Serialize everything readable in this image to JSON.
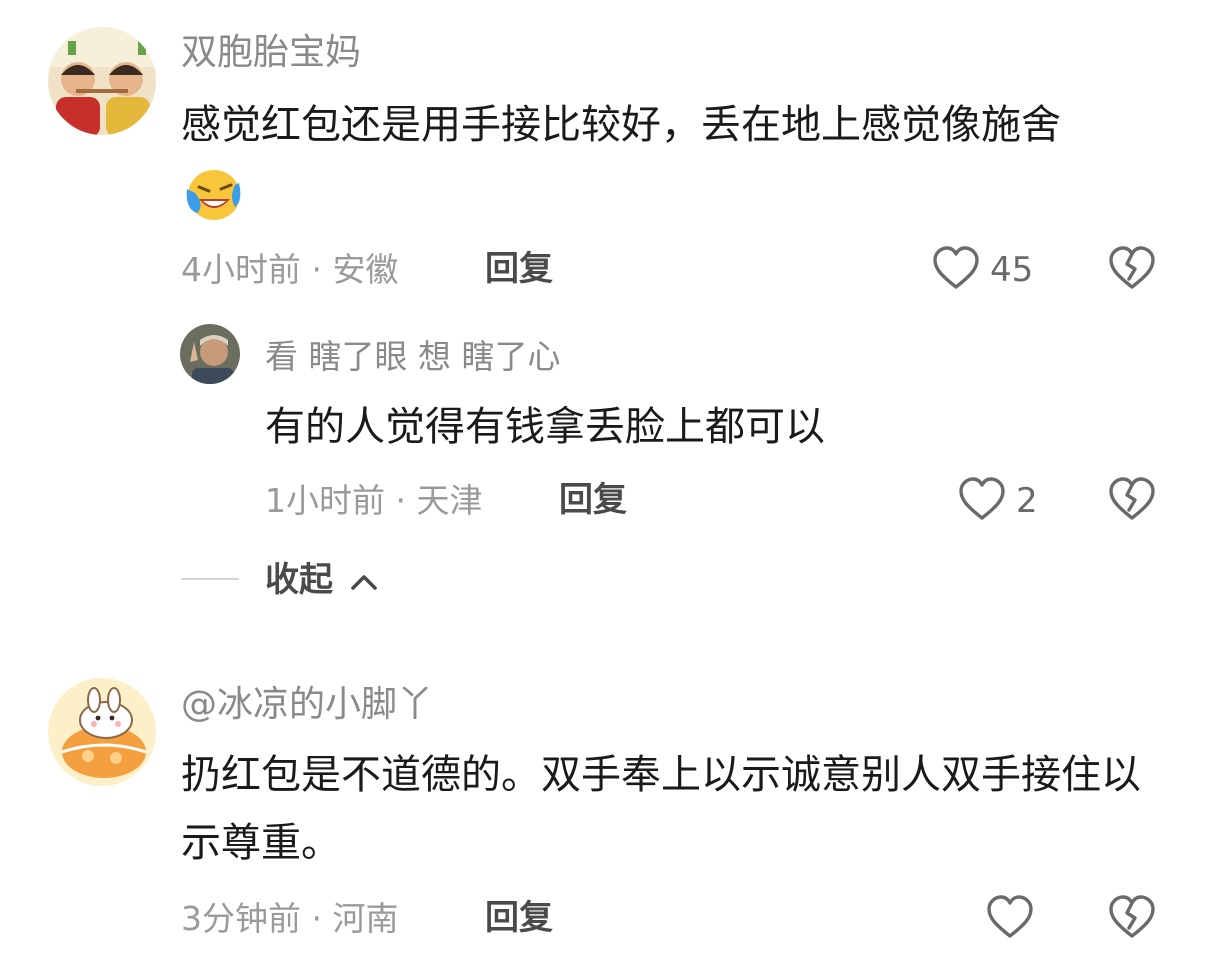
{
  "comments": [
    {
      "username": "双胞胎宝妈",
      "text": "感觉红包还是用手接比较好，丢在地上感觉像施舍",
      "emoji": "laughing-crying-emoji",
      "time": "4小时前",
      "location": "安徽",
      "reply_label": "回复",
      "likes": "45",
      "replies": [
        {
          "username": "看 瞎了眼 想 瞎了心",
          "text": "有的人觉得有钱拿丢脸上都可以",
          "time": "1小时前",
          "location": "天津",
          "reply_label": "回复",
          "likes": "2"
        }
      ],
      "collapse_label": "收起"
    },
    {
      "username": "@冰凉的小脚丫",
      "text": "扔红包是不道德的。双手奉上以示诚意别人双手接住以示尊重。",
      "time": "3分钟前",
      "location": "河南",
      "reply_label": "回复",
      "likes": ""
    }
  ],
  "separator": " · ",
  "icons": {
    "like": "heart-outline-icon",
    "dislike": "broken-heart-icon",
    "collapse": "chevron-up-icon"
  },
  "colors": {
    "text": "#1a1a1a",
    "muted": "#9a9a9a",
    "reply": "#4a4a4a"
  }
}
